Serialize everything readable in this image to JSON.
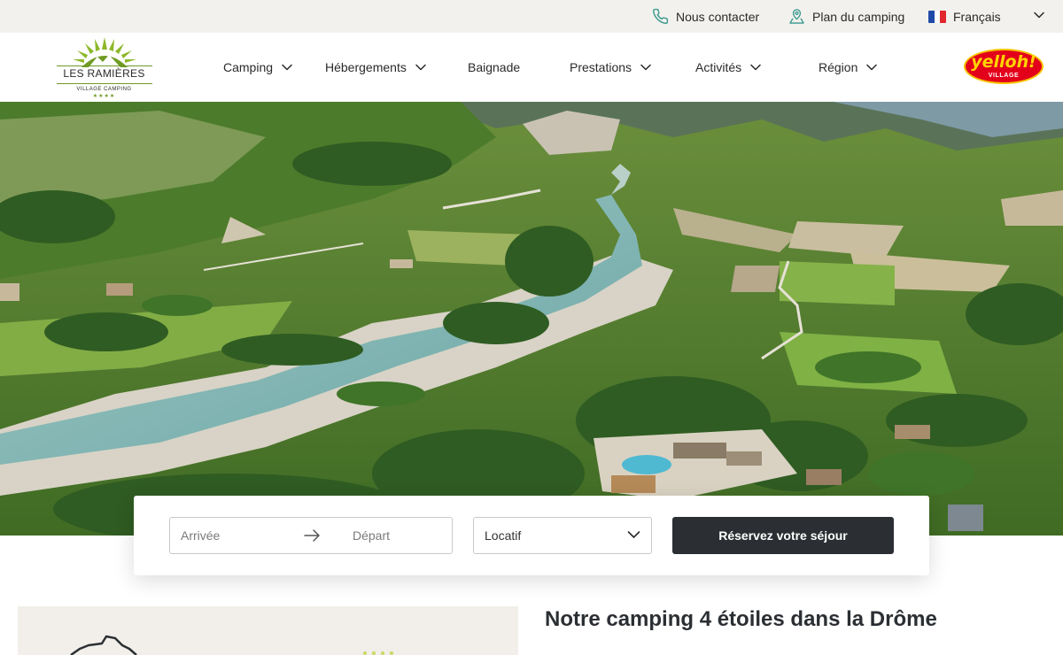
{
  "topbar": {
    "contact_label": "Nous contacter",
    "map_label": "Plan du camping",
    "language_label": "Français",
    "flag_colors": [
      "#1f4aa8",
      "#ffffff",
      "#e1262d"
    ]
  },
  "logo": {
    "title": "LES RAMIÈRES",
    "subtitle": "VILLAGE CAMPING",
    "stars": "★★★★"
  },
  "nav": {
    "items": [
      {
        "label": "Camping",
        "has_dropdown": true
      },
      {
        "label": "Hébergements",
        "has_dropdown": true
      },
      {
        "label": "Baignade",
        "has_dropdown": false
      },
      {
        "label": "Prestations",
        "has_dropdown": true
      },
      {
        "label": "Activités",
        "has_dropdown": true
      },
      {
        "label": "Région",
        "has_dropdown": true
      }
    ]
  },
  "partner_logo": {
    "main": "yelloh!",
    "sub": "VILLAGE"
  },
  "booking": {
    "arrival_placeholder": "Arrivée",
    "departure_placeholder": "Départ",
    "type_value": "Locatif",
    "submit_label": "Réservez votre séjour"
  },
  "intro": {
    "title": "Notre camping 4 étoiles dans la Drôme"
  },
  "colors": {
    "brand_green": "#6f9a23",
    "topbar_bg": "#f3f1ed",
    "button_dark": "#2b2f33",
    "icon_teal": "#3a9a8f"
  },
  "icons": {
    "contact": "phone-icon",
    "map": "location-person-icon",
    "dropdown": "chevron-down-icon",
    "arrow": "arrow-right-icon"
  }
}
